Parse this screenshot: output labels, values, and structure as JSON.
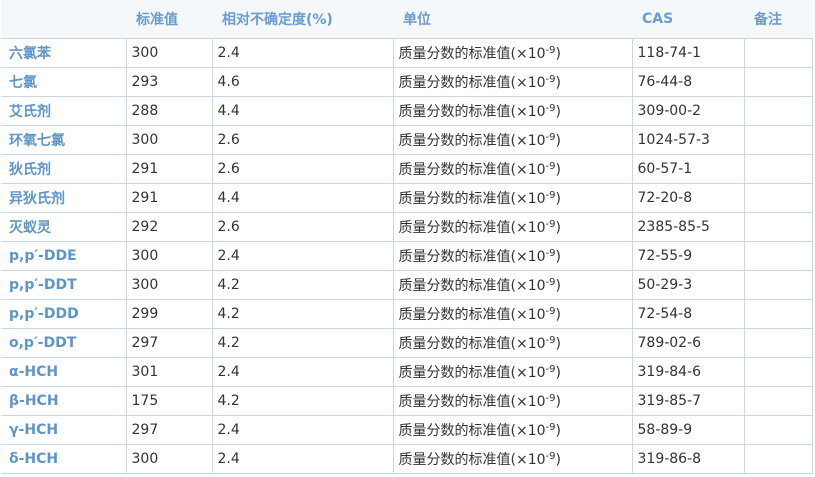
{
  "table": {
    "headers": [
      "",
      "标准值",
      "相对不确定度(%)",
      "单位",
      "CAS",
      "备注"
    ],
    "unit_prefix": "质量分数的标准值(×10",
    "unit_exponent": "-9",
    "unit_suffix": ")",
    "rows": [
      {
        "name": "六氯苯",
        "value": "300",
        "uncertainty": "2.4",
        "cas": "118-74-1",
        "note": ""
      },
      {
        "name": "七氯",
        "value": "293",
        "uncertainty": "4.6",
        "cas": "76-44-8",
        "note": ""
      },
      {
        "name": "艾氏剂",
        "value": "288",
        "uncertainty": "4.4",
        "cas": "309-00-2",
        "note": ""
      },
      {
        "name": "环氧七氯",
        "value": "300",
        "uncertainty": "2.6",
        "cas": "1024-57-3",
        "note": ""
      },
      {
        "name": "狄氏剂",
        "value": "291",
        "uncertainty": "2.6",
        "cas": "60-57-1",
        "note": ""
      },
      {
        "name": "异狄氏剂",
        "value": "291",
        "uncertainty": "4.4",
        "cas": "72-20-8",
        "note": ""
      },
      {
        "name": "灭蚁灵",
        "value": "292",
        "uncertainty": "2.6",
        "cas": "2385-85-5",
        "note": ""
      },
      {
        "name": "p,p′-DDE",
        "value": "300",
        "uncertainty": "2.4",
        "cas": "72-55-9",
        "note": ""
      },
      {
        "name": "p,p′-DDT",
        "value": "300",
        "uncertainty": "4.2",
        "cas": "50-29-3",
        "note": ""
      },
      {
        "name": "p,p′-DDD",
        "value": "299",
        "uncertainty": "4.2",
        "cas": "72-54-8",
        "note": ""
      },
      {
        "name": "o,p′-DDT",
        "value": "297",
        "uncertainty": "4.2",
        "cas": "789-02-6",
        "note": ""
      },
      {
        "name": "α-HCH",
        "value": "301",
        "uncertainty": "2.4",
        "cas": "319-84-6",
        "note": ""
      },
      {
        "name": "β-HCH",
        "value": "175",
        "uncertainty": "4.2",
        "cas": "319-85-7",
        "note": ""
      },
      {
        "name": "γ-HCH",
        "value": "297",
        "uncertainty": "2.4",
        "cas": "58-89-9",
        "note": ""
      },
      {
        "name": "δ-HCH",
        "value": "300",
        "uncertainty": "2.4",
        "cas": "319-86-8",
        "note": ""
      }
    ]
  }
}
